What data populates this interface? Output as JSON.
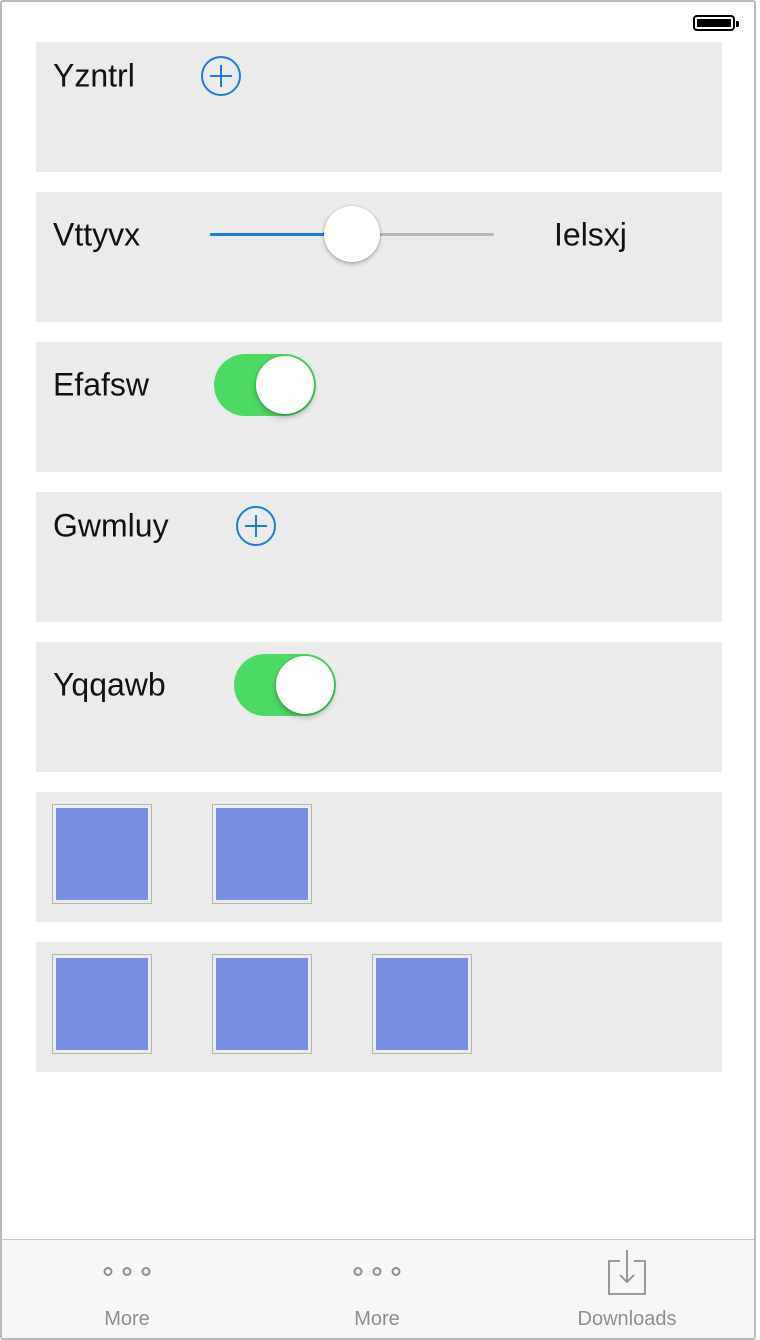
{
  "status_bar": {
    "battery_icon": "battery-full-icon"
  },
  "rows": {
    "row1": {
      "label": "Yzntrl",
      "control": "add-circle-icon"
    },
    "row2": {
      "label": "Vttyvx",
      "right_label": "Ielsxj",
      "slider_value_fraction": 0.5
    },
    "row3": {
      "label": "Efafsw",
      "switch_on": true
    },
    "row4": {
      "label": "Gwmluy",
      "control": "add-circle-icon"
    },
    "row5": {
      "label": "Yqqawb",
      "switch_on": true
    },
    "row6": {
      "tiles": 2
    },
    "row7": {
      "tiles": 3
    }
  },
  "tab_bar": {
    "items": [
      {
        "label": "More",
        "icon": "more-dots-icon"
      },
      {
        "label": "More",
        "icon": "more-dots-icon"
      },
      {
        "label": "Downloads",
        "icon": "download-tray-icon"
      }
    ]
  },
  "colors": {
    "accent": "#1e7ae6",
    "switch_on": "#4cd964",
    "tile": "#7890e3",
    "card_background": "#ebebeb",
    "tab_label": "#8e8e8e"
  }
}
